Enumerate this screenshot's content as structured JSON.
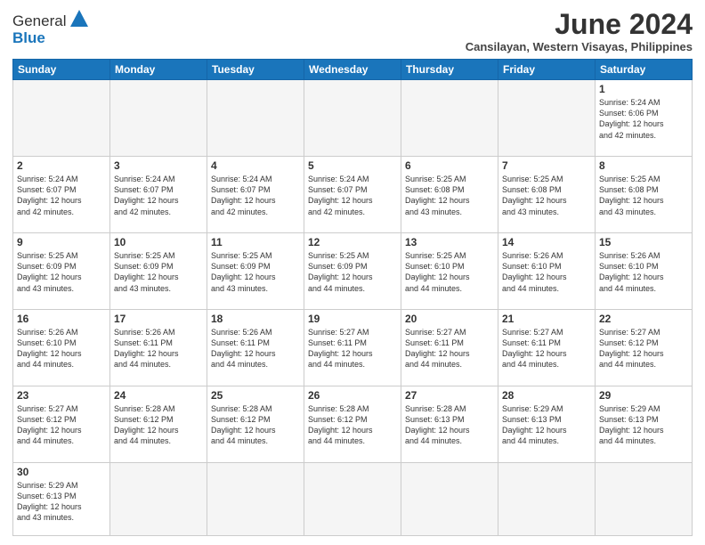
{
  "header": {
    "logo_text_normal": "General",
    "logo_text_bold": "Blue",
    "month_title": "June 2024",
    "subtitle": "Cansilayan, Western Visayas, Philippines"
  },
  "weekdays": [
    "Sunday",
    "Monday",
    "Tuesday",
    "Wednesday",
    "Thursday",
    "Friday",
    "Saturday"
  ],
  "weeks": [
    [
      {
        "day": "",
        "empty": true
      },
      {
        "day": "",
        "empty": true
      },
      {
        "day": "",
        "empty": true
      },
      {
        "day": "",
        "empty": true
      },
      {
        "day": "",
        "empty": true
      },
      {
        "day": "",
        "empty": true
      },
      {
        "day": "1",
        "sunrise": "5:24 AM",
        "sunset": "6:06 PM",
        "daylight": "12 hours and 42 minutes."
      }
    ],
    [
      {
        "day": "2",
        "sunrise": "5:24 AM",
        "sunset": "6:07 PM",
        "daylight": "12 hours and 42 minutes."
      },
      {
        "day": "3",
        "sunrise": "5:24 AM",
        "sunset": "6:07 PM",
        "daylight": "12 hours and 42 minutes."
      },
      {
        "day": "4",
        "sunrise": "5:24 AM",
        "sunset": "6:07 PM",
        "daylight": "12 hours and 42 minutes."
      },
      {
        "day": "5",
        "sunrise": "5:24 AM",
        "sunset": "6:07 PM",
        "daylight": "12 hours and 42 minutes."
      },
      {
        "day": "6",
        "sunrise": "5:25 AM",
        "sunset": "6:08 PM",
        "daylight": "12 hours and 43 minutes."
      },
      {
        "day": "7",
        "sunrise": "5:25 AM",
        "sunset": "6:08 PM",
        "daylight": "12 hours and 43 minutes."
      },
      {
        "day": "8",
        "sunrise": "5:25 AM",
        "sunset": "6:08 PM",
        "daylight": "12 hours and 43 minutes."
      }
    ],
    [
      {
        "day": "9",
        "sunrise": "5:25 AM",
        "sunset": "6:09 PM",
        "daylight": "12 hours and 43 minutes."
      },
      {
        "day": "10",
        "sunrise": "5:25 AM",
        "sunset": "6:09 PM",
        "daylight": "12 hours and 43 minutes."
      },
      {
        "day": "11",
        "sunrise": "5:25 AM",
        "sunset": "6:09 PM",
        "daylight": "12 hours and 43 minutes."
      },
      {
        "day": "12",
        "sunrise": "5:25 AM",
        "sunset": "6:09 PM",
        "daylight": "12 hours and 44 minutes."
      },
      {
        "day": "13",
        "sunrise": "5:25 AM",
        "sunset": "6:10 PM",
        "daylight": "12 hours and 44 minutes."
      },
      {
        "day": "14",
        "sunrise": "5:26 AM",
        "sunset": "6:10 PM",
        "daylight": "12 hours and 44 minutes."
      },
      {
        "day": "15",
        "sunrise": "5:26 AM",
        "sunset": "6:10 PM",
        "daylight": "12 hours and 44 minutes."
      }
    ],
    [
      {
        "day": "16",
        "sunrise": "5:26 AM",
        "sunset": "6:10 PM",
        "daylight": "12 hours and 44 minutes."
      },
      {
        "day": "17",
        "sunrise": "5:26 AM",
        "sunset": "6:11 PM",
        "daylight": "12 hours and 44 minutes."
      },
      {
        "day": "18",
        "sunrise": "5:26 AM",
        "sunset": "6:11 PM",
        "daylight": "12 hours and 44 minutes."
      },
      {
        "day": "19",
        "sunrise": "5:27 AM",
        "sunset": "6:11 PM",
        "daylight": "12 hours and 44 minutes."
      },
      {
        "day": "20",
        "sunrise": "5:27 AM",
        "sunset": "6:11 PM",
        "daylight": "12 hours and 44 minutes."
      },
      {
        "day": "21",
        "sunrise": "5:27 AM",
        "sunset": "6:11 PM",
        "daylight": "12 hours and 44 minutes."
      },
      {
        "day": "22",
        "sunrise": "5:27 AM",
        "sunset": "6:12 PM",
        "daylight": "12 hours and 44 minutes."
      }
    ],
    [
      {
        "day": "23",
        "sunrise": "5:27 AM",
        "sunset": "6:12 PM",
        "daylight": "12 hours and 44 minutes."
      },
      {
        "day": "24",
        "sunrise": "5:28 AM",
        "sunset": "6:12 PM",
        "daylight": "12 hours and 44 minutes."
      },
      {
        "day": "25",
        "sunrise": "5:28 AM",
        "sunset": "6:12 PM",
        "daylight": "12 hours and 44 minutes."
      },
      {
        "day": "26",
        "sunrise": "5:28 AM",
        "sunset": "6:12 PM",
        "daylight": "12 hours and 44 minutes."
      },
      {
        "day": "27",
        "sunrise": "5:28 AM",
        "sunset": "6:13 PM",
        "daylight": "12 hours and 44 minutes."
      },
      {
        "day": "28",
        "sunrise": "5:29 AM",
        "sunset": "6:13 PM",
        "daylight": "12 hours and 44 minutes."
      },
      {
        "day": "29",
        "sunrise": "5:29 AM",
        "sunset": "6:13 PM",
        "daylight": "12 hours and 44 minutes."
      }
    ],
    [
      {
        "day": "30",
        "sunrise": "5:29 AM",
        "sunset": "6:13 PM",
        "daylight": "12 hours and 43 minutes.",
        "last": true
      },
      {
        "day": "",
        "empty": true,
        "last": true
      },
      {
        "day": "",
        "empty": true,
        "last": true
      },
      {
        "day": "",
        "empty": true,
        "last": true
      },
      {
        "day": "",
        "empty": true,
        "last": true
      },
      {
        "day": "",
        "empty": true,
        "last": true
      },
      {
        "day": "",
        "empty": true,
        "last": true
      }
    ]
  ],
  "labels": {
    "sunrise": "Sunrise:",
    "sunset": "Sunset:",
    "daylight": "Daylight:"
  }
}
